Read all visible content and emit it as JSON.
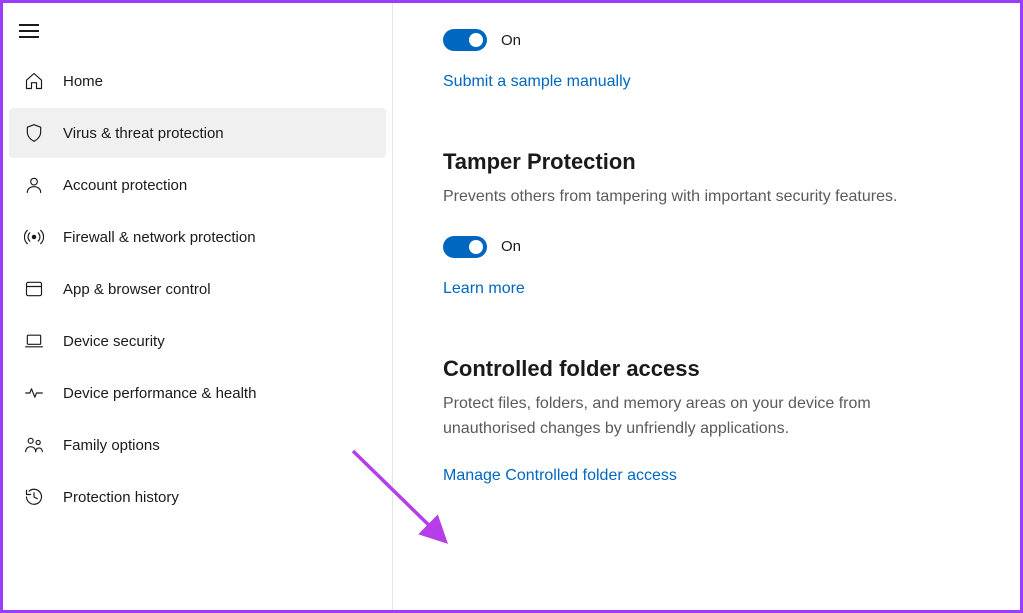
{
  "sidebar": {
    "items": [
      {
        "label": "Home"
      },
      {
        "label": "Virus & threat protection"
      },
      {
        "label": "Account protection"
      },
      {
        "label": "Firewall & network protection"
      },
      {
        "label": "App & browser control"
      },
      {
        "label": "Device security"
      },
      {
        "label": "Device performance & health"
      },
      {
        "label": "Family options"
      },
      {
        "label": "Protection history"
      }
    ]
  },
  "main": {
    "toggle1_state": "On",
    "submit_sample_link": "Submit a sample manually",
    "tamper": {
      "title": "Tamper Protection",
      "desc": "Prevents others from tampering with important security features.",
      "toggle_state": "On",
      "learn_link": "Learn more"
    },
    "cfa": {
      "title": "Controlled folder access",
      "desc": "Protect files, folders, and memory areas on your device from unauthorised changes by unfriendly applications.",
      "manage_link": "Manage Controlled folder access"
    }
  }
}
